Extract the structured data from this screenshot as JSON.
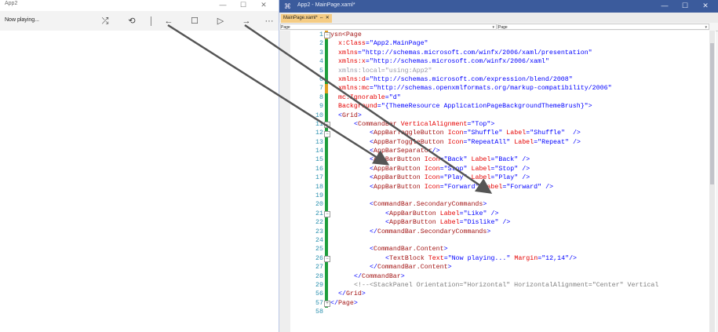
{
  "app": {
    "title": "App2",
    "window_controls": {
      "minimize": "—",
      "maximize": "☐",
      "close": "✕"
    },
    "now_playing": "Now playing...",
    "commands": {
      "shuffle": "⤮",
      "repeat": "⟲",
      "back": "←",
      "stop": "☐",
      "play": "▷",
      "forward": "→",
      "more": "···"
    }
  },
  "vs": {
    "title": "App2 - MainPage.xaml*",
    "logo": "⌘",
    "window_controls": {
      "minimize": "—",
      "maximize": "☐",
      "close": "✕"
    },
    "tab": {
      "label": "MainPage.xaml*",
      "pin": "⇔",
      "close": "✕"
    },
    "nav": {
      "left": "Page",
      "right": "Page"
    },
    "split": "+",
    "line_numbers": [
      "1",
      "2",
      "3",
      "4",
      "5",
      "6",
      "7",
      "8",
      "9",
      "10",
      "11",
      "12",
      "13",
      "14",
      "15",
      "16",
      "17",
      "18",
      "19",
      "20",
      "21",
      "22",
      "23",
      "24",
      "25",
      "26",
      "27",
      "28",
      "29",
      "56",
      "57",
      "58"
    ],
    "code": [
      {
        "indent": 0,
        "parts": [
          [
            "tag",
            "ysn<"
          ],
          [
            "tag",
            "Page"
          ]
        ]
      },
      {
        "indent": 2,
        "parts": [
          [
            "attr",
            "x:Class"
          ],
          [
            "br",
            "="
          ],
          [
            "val",
            "\"App2.MainPage\""
          ]
        ]
      },
      {
        "indent": 2,
        "parts": [
          [
            "attr",
            "xmlns"
          ],
          [
            "br",
            "="
          ],
          [
            "val",
            "\"http://schemas.microsoft.com/winfx/2006/xaml/presentation\""
          ]
        ]
      },
      {
        "indent": 2,
        "parts": [
          [
            "attr",
            "xmlns:x"
          ],
          [
            "br",
            "="
          ],
          [
            "val",
            "\"http://schemas.microsoft.com/winfx/2006/xaml\""
          ]
        ]
      },
      {
        "indent": 2,
        "parts": [
          [
            "dim",
            "xmlns:local"
          ],
          [
            "dim",
            "="
          ],
          [
            "dim",
            "\"using:App2\""
          ]
        ]
      },
      {
        "indent": 2,
        "parts": [
          [
            "attr",
            "xmlns:d"
          ],
          [
            "br",
            "="
          ],
          [
            "val",
            "\"http://schemas.microsoft.com/expression/blend/2008\""
          ]
        ]
      },
      {
        "indent": 2,
        "parts": [
          [
            "attr",
            "xmlns:mc"
          ],
          [
            "br",
            "="
          ],
          [
            "val",
            "\"http://schemas.openxmlformats.org/markup-compatibility/2006\""
          ]
        ]
      },
      {
        "indent": 2,
        "parts": [
          [
            "attr",
            "mc:Ignorable"
          ],
          [
            "br",
            "="
          ],
          [
            "val",
            "\"d\""
          ]
        ]
      },
      {
        "indent": 2,
        "parts": [
          [
            "attr",
            "Background"
          ],
          [
            "br",
            "="
          ],
          [
            "val",
            "\"{ThemeResource ApplicationPageBackgroundThemeBrush}\""
          ],
          [
            "br",
            ">"
          ]
        ]
      },
      {
        "indent": 2,
        "parts": [
          [
            "br",
            "<"
          ],
          [
            "tag",
            "Grid"
          ],
          [
            "br",
            ">"
          ]
        ]
      },
      {
        "indent": 6,
        "parts": [
          [
            "br",
            "<"
          ],
          [
            "tag",
            "CommandBar "
          ],
          [
            "attr",
            "VerticalAlignment"
          ],
          [
            "br",
            "="
          ],
          [
            "val",
            "\"Top\""
          ],
          [
            "br",
            ">"
          ]
        ]
      },
      {
        "indent": 10,
        "parts": [
          [
            "br",
            "<"
          ],
          [
            "tag",
            "AppBarToggleButton "
          ],
          [
            "attr",
            "Icon"
          ],
          [
            "br",
            "="
          ],
          [
            "val",
            "\"Shuffle\" "
          ],
          [
            "attr",
            "Label"
          ],
          [
            "br",
            "="
          ],
          [
            "val",
            "\"Shuffle\""
          ],
          [
            "br",
            "  />"
          ]
        ]
      },
      {
        "indent": 10,
        "parts": [
          [
            "br",
            "<"
          ],
          [
            "tag",
            "AppBarToggleButton "
          ],
          [
            "attr",
            "Icon"
          ],
          [
            "br",
            "="
          ],
          [
            "val",
            "\"RepeatAll\" "
          ],
          [
            "attr",
            "Label"
          ],
          [
            "br",
            "="
          ],
          [
            "val",
            "\"Repeat\""
          ],
          [
            "br",
            " />"
          ]
        ]
      },
      {
        "indent": 10,
        "parts": [
          [
            "br",
            "<"
          ],
          [
            "tag",
            "AppBarSeparator"
          ],
          [
            "br",
            "/>"
          ]
        ]
      },
      {
        "indent": 10,
        "parts": [
          [
            "br",
            "<"
          ],
          [
            "tag",
            "AppBarButton "
          ],
          [
            "attr",
            "Icon"
          ],
          [
            "br",
            "="
          ],
          [
            "val",
            "\"Back\" "
          ],
          [
            "attr",
            "Label"
          ],
          [
            "br",
            "="
          ],
          [
            "val",
            "\"Back\""
          ],
          [
            "br",
            " />"
          ]
        ]
      },
      {
        "indent": 10,
        "parts": [
          [
            "br",
            "<"
          ],
          [
            "tag",
            "AppBarButton "
          ],
          [
            "attr",
            "Icon"
          ],
          [
            "br",
            "="
          ],
          [
            "val",
            "\"Stop\" "
          ],
          [
            "attr",
            "Label"
          ],
          [
            "br",
            "="
          ],
          [
            "val",
            "\"Stop\""
          ],
          [
            "br",
            " />"
          ]
        ]
      },
      {
        "indent": 10,
        "parts": [
          [
            "br",
            "<"
          ],
          [
            "tag",
            "AppBarButton "
          ],
          [
            "attr",
            "Icon"
          ],
          [
            "br",
            "="
          ],
          [
            "val",
            "\"Play\" "
          ],
          [
            "attr",
            "Label"
          ],
          [
            "br",
            "="
          ],
          [
            "val",
            "\"Play\""
          ],
          [
            "br",
            " />"
          ]
        ]
      },
      {
        "indent": 10,
        "parts": [
          [
            "br",
            "<"
          ],
          [
            "tag",
            "AppBarButton "
          ],
          [
            "attr",
            "Icon"
          ],
          [
            "br",
            "="
          ],
          [
            "val",
            "\"Forward\" "
          ],
          [
            "attr",
            "Label"
          ],
          [
            "br",
            "="
          ],
          [
            "val",
            "\"Forward\""
          ],
          [
            "br",
            " />"
          ]
        ]
      },
      {
        "indent": 0,
        "parts": []
      },
      {
        "indent": 10,
        "parts": [
          [
            "br",
            "<"
          ],
          [
            "tag",
            "CommandBar.SecondaryCommands"
          ],
          [
            "br",
            ">"
          ]
        ]
      },
      {
        "indent": 14,
        "parts": [
          [
            "br",
            "<"
          ],
          [
            "tag",
            "AppBarButton "
          ],
          [
            "attr",
            "Label"
          ],
          [
            "br",
            "="
          ],
          [
            "val",
            "\"Like\""
          ],
          [
            "br",
            " />"
          ]
        ]
      },
      {
        "indent": 14,
        "parts": [
          [
            "br",
            "<"
          ],
          [
            "tag",
            "AppBarButton "
          ],
          [
            "attr",
            "Label"
          ],
          [
            "br",
            "="
          ],
          [
            "val",
            "\"Dislike\""
          ],
          [
            "br",
            " />"
          ]
        ]
      },
      {
        "indent": 10,
        "parts": [
          [
            "br",
            "</"
          ],
          [
            "tag",
            "CommandBar.SecondaryCommands"
          ],
          [
            "br",
            ">"
          ]
        ]
      },
      {
        "indent": 0,
        "parts": []
      },
      {
        "indent": 10,
        "parts": [
          [
            "br",
            "<"
          ],
          [
            "tag",
            "CommandBar.Content"
          ],
          [
            "br",
            ">"
          ]
        ]
      },
      {
        "indent": 14,
        "parts": [
          [
            "br",
            "<"
          ],
          [
            "tag",
            "TextBlock "
          ],
          [
            "attr",
            "Text"
          ],
          [
            "br",
            "="
          ],
          [
            "val",
            "\"Now playing...\" "
          ],
          [
            "attr",
            "Margin"
          ],
          [
            "br",
            "="
          ],
          [
            "val",
            "\"12,14\""
          ],
          [
            "br",
            "/>"
          ]
        ]
      },
      {
        "indent": 10,
        "parts": [
          [
            "br",
            "</"
          ],
          [
            "tag",
            "CommandBar.Content"
          ],
          [
            "br",
            ">"
          ]
        ]
      },
      {
        "indent": 6,
        "parts": [
          [
            "br",
            "</"
          ],
          [
            "tag",
            "CommandBar"
          ],
          [
            "br",
            ">"
          ]
        ]
      },
      {
        "indent": 6,
        "parts": [
          [
            "cmt",
            "<!--<StackPanel Orientation=\"Horizontal\" HorizontalAlignment=\"Center\" Vertical"
          ]
        ]
      },
      {
        "indent": 2,
        "parts": [
          [
            "br",
            "</"
          ],
          [
            "tag",
            "Grid"
          ],
          [
            "br",
            ">"
          ]
        ]
      },
      {
        "indent": 0,
        "parts": [
          [
            "br",
            "</"
          ],
          [
            "tag",
            "Page"
          ],
          [
            "br",
            ">"
          ]
        ]
      },
      {
        "indent": 0,
        "parts": []
      }
    ],
    "change_marks": [
      "#e0a020",
      "#1e9e3c",
      "#1e9e3c",
      "#1e9e3c",
      "#1e9e3c",
      "#1e9e3c",
      "#e0a020",
      "#1e9e3c",
      "#1e9e3c",
      "#1e9e3c",
      "#1e9e3c",
      "#1e9e3c",
      "#1e9e3c",
      "#1e9e3c",
      "#1e9e3c",
      "#1e9e3c",
      "#1e9e3c",
      "#1e9e3c",
      "#1e9e3c",
      "#1e9e3c",
      "#1e9e3c",
      "#1e9e3c",
      "#1e9e3c",
      "#1e9e3c",
      "#1e9e3c",
      "#1e9e3c",
      "#1e9e3c",
      "#1e9e3c",
      "#1e9e3c",
      "#1e9e3c",
      "#1e9e3c",
      ""
    ]
  },
  "colors": {
    "arrow": "#555555",
    "vs_title": "#3b5b9c",
    "tab_active": "#f5cc84"
  }
}
